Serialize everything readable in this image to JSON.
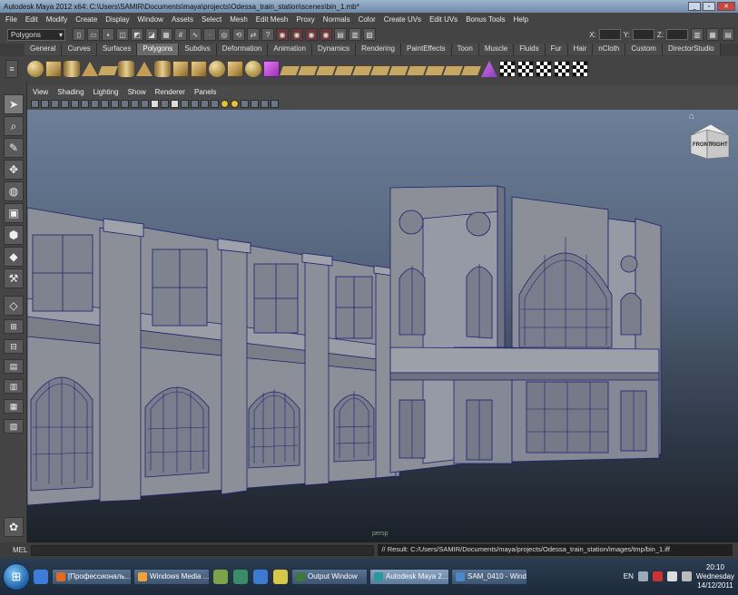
{
  "window": {
    "title": "Autodesk Maya 2012 x64: C:\\Users\\SAMIR\\Documents\\maya\\projects\\Odessa_train_station\\scenes\\bin_1.mb*",
    "controls": [
      "minimize",
      "maximize",
      "close"
    ]
  },
  "menubar": [
    "File",
    "Edit",
    "Modify",
    "Create",
    "Display",
    "Window",
    "Assets",
    "Select",
    "Mesh",
    "Edit Mesh",
    "Proxy",
    "Normals",
    "Color",
    "Create UVs",
    "Edit UVs",
    "Bonus Tools",
    "Help"
  ],
  "statusline": {
    "mode": "Polygons",
    "x_label": "X:",
    "y_label": "Y:",
    "z_label": "Z:"
  },
  "shelf_tabs": [
    "General",
    "Curves",
    "Surfaces",
    "Polygons",
    "Subdivs",
    "Deformation",
    "Animation",
    "Dynamics",
    "Rendering",
    "PaintEffects",
    "Toon",
    "Muscle",
    "Fluids",
    "Fur",
    "Hair",
    "nCloth",
    "Custom",
    "DirectorStudio"
  ],
  "active_shelf": "Polygons",
  "panel_menu": [
    "View",
    "Shading",
    "Lighting",
    "Show",
    "Renderer",
    "Panels"
  ],
  "viewcube": {
    "front": "FRONT",
    "right": "RIGHT"
  },
  "camera": "persp",
  "mel": {
    "label": "MEL",
    "result": "// Result: C:/Users/SAMIR/Documents/maya/projects/Odessa_train_station/images/tmp/bin_1.iff"
  },
  "taskbar": {
    "items": [
      {
        "label": "[Профессиональ...",
        "color": "#e56b1f"
      },
      {
        "label": "Windows Media ...",
        "color": "#f2a33a"
      },
      {
        "label": "Output Window",
        "color": "#3b7a3b"
      },
      {
        "label": "Autodesk Maya 2...",
        "color": "#2a9a9a"
      },
      {
        "label": "SAM_0410 - Wind...",
        "color": "#4a88c8"
      }
    ],
    "lang": "EN",
    "time": "20:10",
    "day": "Wednesday",
    "date": "14/12/2011"
  },
  "colors": {
    "viewport_top": "#6c7f98",
    "viewport_bottom": "#1b2129",
    "wire": "#1c1f6e",
    "building": "#8c8f98"
  }
}
